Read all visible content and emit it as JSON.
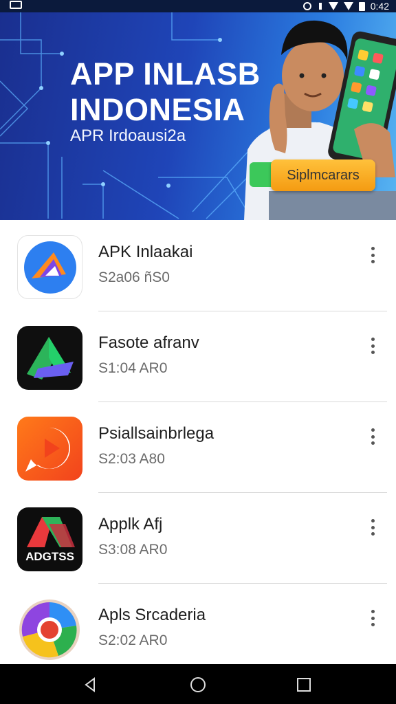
{
  "status_bar": {
    "time": "0:42",
    "icons": [
      "photo-icon",
      "sync-icon",
      "vibrate-icon",
      "wifi-icon",
      "battery-icon"
    ]
  },
  "banner": {
    "title_line1": "APP INLASB",
    "title_line2": "INDONESIA",
    "subtitle": "APR Irdoausi2a",
    "button_label": "Siplmcarars",
    "colors": {
      "start": "#1a2f8f",
      "end": "#59b6f2",
      "button": "#f4a620"
    }
  },
  "apps": [
    {
      "name": "APK Inlaakai",
      "meta": "S2a06 ñS0",
      "icon": "blue-triangle-app-icon"
    },
    {
      "name": "Fasote afranv",
      "meta": "S1:04 AR0",
      "icon": "green-a-app-icon"
    },
    {
      "name": "Psiallsainbrlega",
      "meta": "S2:03 A80",
      "icon": "orange-play-app-icon"
    },
    {
      "name": "Applk Afj",
      "meta": "S3:08 AR0",
      "icon_text": "ADGTSS",
      "icon": "adgtss-app-icon"
    },
    {
      "name": "Apls Srcaderia",
      "meta": "S2:02 AR0",
      "icon": "chrome-style-app-icon"
    }
  ],
  "nav": {
    "back": "back-icon",
    "home": "home-icon",
    "recents": "recents-icon"
  }
}
